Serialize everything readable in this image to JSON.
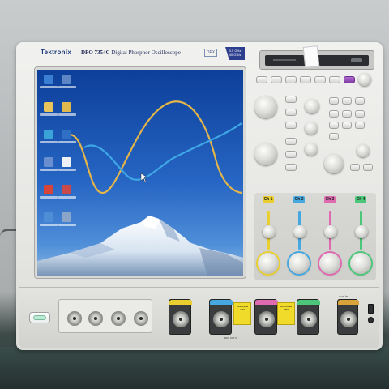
{
  "instrument": {
    "brand": "Tektronix",
    "model": "DPO 7354C",
    "model_desc": "Digital Phosphor Oscilloscope",
    "dpx_logo": "DPX",
    "spec_badge": [
      "3.5 GHz",
      "40 GS/s"
    ]
  },
  "front_panel": {
    "channels": [
      "Ch 1",
      "Ch 2",
      "Ch 3",
      "Ch 4"
    ],
    "channel_colors": [
      "#e9cf30",
      "#46a8e0",
      "#e06ab0",
      "#4cc77a"
    ],
    "caution_label": [
      "CAUTION",
      "≤5V"
    ],
    "voltage_note": "300V CAT II",
    "aux_label": "Aux In"
  },
  "screen": {
    "waveform_colors": {
      "trace_1": "#e3b54a",
      "trace_2": "#3fa6e6"
    }
  }
}
